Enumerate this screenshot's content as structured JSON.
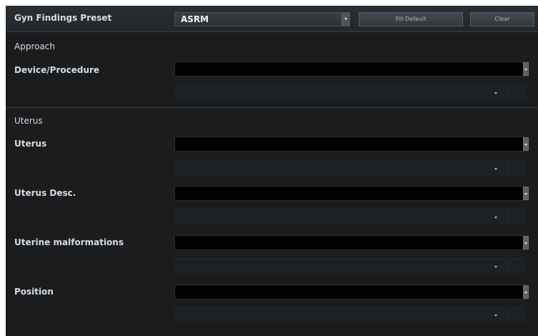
{
  "header": {
    "label": "Gyn Findings Preset",
    "preset_value": "ASRM",
    "fill_default_label": "Fill Default",
    "clear_label": "Clear"
  },
  "sections": {
    "approach": {
      "title": "Approach",
      "fields": {
        "device_procedure": {
          "label": "Device/Procedure",
          "value": ""
        }
      }
    },
    "uterus": {
      "title": "Uterus",
      "fields": {
        "uterus": {
          "label": "Uterus",
          "value": ""
        },
        "uterus_desc": {
          "label": "Uterus Desc.",
          "value": ""
        },
        "uterine_malformations": {
          "label": "Uterine malformations",
          "value": ""
        },
        "position": {
          "label": "Position",
          "value": ""
        }
      }
    }
  },
  "colors": {
    "panel_bg": "#1a1c1e",
    "header_bg": "#2b2f33",
    "input_bg": "#010101",
    "text": "#e2e6ea",
    "button_text": "#aeb5bc"
  }
}
